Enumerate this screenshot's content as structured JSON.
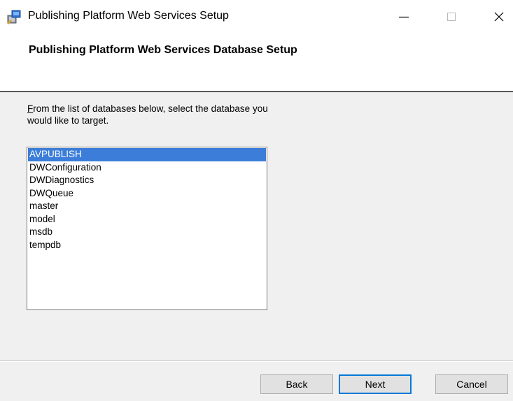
{
  "window": {
    "title": "Publishing Platform Web Services Setup",
    "app_icon": "installer-icon",
    "controls": {
      "minimize_icon": "minimize-icon",
      "maximize_icon": "maximize-icon",
      "close_icon": "close-icon"
    }
  },
  "header": {
    "title": "Publishing Platform Web Services Database Setup"
  },
  "body": {
    "instruction_first_letter": "F",
    "instruction_rest": "rom the list of databases below, select the database you would like to target.",
    "database_list": {
      "items": [
        "AVPUBLISH",
        "DWConfiguration",
        "DWDiagnostics",
        "DWQueue",
        "master",
        "model",
        "msdb",
        "tempdb"
      ],
      "selected": "AVPUBLISH"
    }
  },
  "footer": {
    "back_label": "Back",
    "next_label": "Next",
    "cancel_label": "Cancel"
  },
  "colors": {
    "selection": "#3b7dd8",
    "default_button_border": "#0078d7",
    "body_background": "#f0f0f0"
  }
}
